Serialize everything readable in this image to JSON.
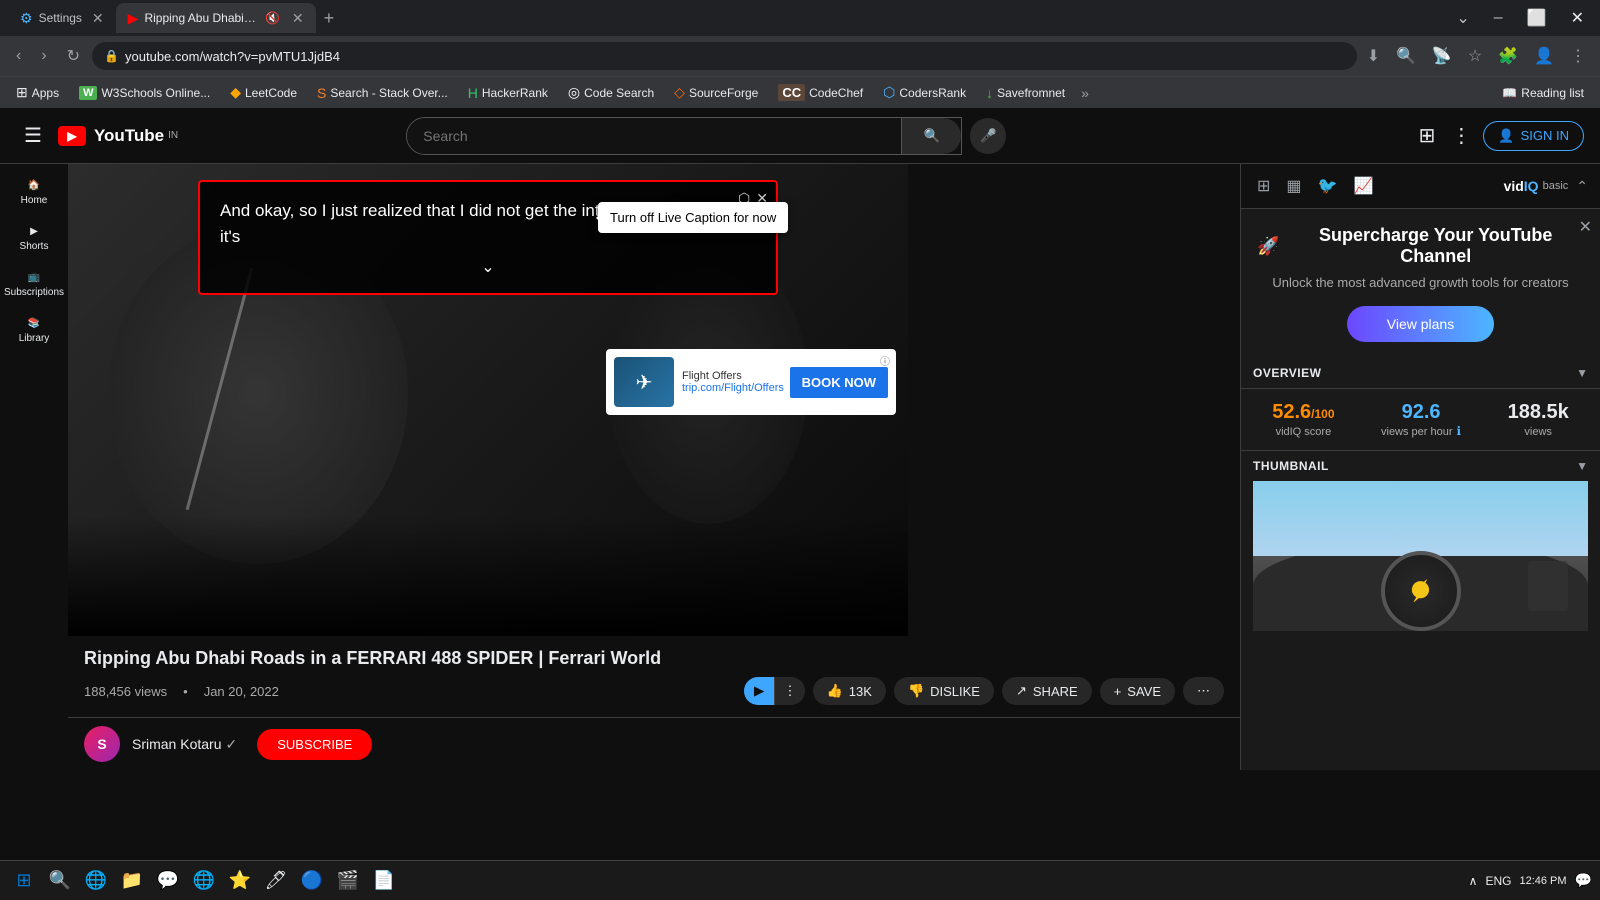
{
  "browser": {
    "tabs": [
      {
        "id": "settings",
        "title": "Settings",
        "favicon": "⚙",
        "active": false
      },
      {
        "id": "youtube",
        "title": "Ripping Abu Dhabi Roads in...",
        "favicon": "▶",
        "active": true,
        "muted": true
      }
    ],
    "address": "youtube.com/watch?v=pvMTU1JjdB4",
    "window_controls": [
      "⌄",
      "–",
      "⬜",
      "✕"
    ]
  },
  "bookmarks": [
    {
      "id": "apps",
      "label": "Apps",
      "icon": "⊞"
    },
    {
      "id": "w3schools",
      "label": "W3Schools Online...",
      "icon": "W"
    },
    {
      "id": "leetcode",
      "label": "LeetCode",
      "icon": "◆"
    },
    {
      "id": "stackoverflow",
      "label": "Search - Stack Over...",
      "icon": "S"
    },
    {
      "id": "hackerrank",
      "label": "HackerRank",
      "icon": "H"
    },
    {
      "id": "codesearch",
      "label": "Code Search",
      "icon": "◎"
    },
    {
      "id": "sourceforge",
      "label": "SourceForge",
      "icon": "◇"
    },
    {
      "id": "codechef",
      "label": "CodeChef",
      "icon": "C"
    },
    {
      "id": "codersrank",
      "label": "CodersRank",
      "icon": "⬡"
    },
    {
      "id": "savefromnet",
      "label": "Savefromnet",
      "icon": "↓"
    }
  ],
  "youtube": {
    "header": {
      "search_placeholder": "Search",
      "sign_in_label": "SIGN IN"
    },
    "video": {
      "title": "Ripping Abu Dhabi Roads in a FERRARI 488 SPIDER | Ferrari World",
      "views": "188,456 views",
      "date": "Jan 20, 2022",
      "likes": "13K",
      "channel": "Sriman Kotaru",
      "verified": true
    },
    "caption": {
      "text": "And okay, so I just realized that I did not get the intro till now so yeah it's",
      "turn_off_label": "Turn off Live Caption for now"
    },
    "ad": {
      "title": "Flight Offers",
      "url": "trip.com/Flight/Offers",
      "cta": "BOOK NOW"
    },
    "actions": {
      "like": "13K",
      "dislike": "DISLIKE",
      "share": "SHARE",
      "save": "SAVE"
    }
  },
  "vidiq": {
    "logo_text": "vidIQ",
    "plan": "basic",
    "promo": {
      "emoji": "🚀",
      "title": "Supercharge Your YouTube Channel",
      "subtitle": "Unlock the most advanced growth tools for creators",
      "cta": "View plans"
    },
    "overview_label": "OVERVIEW",
    "stats": [
      {
        "value": "52.6",
        "suffix": "/100",
        "label": "vidIQ score",
        "color": "orange"
      },
      {
        "value": "92.6",
        "suffix": "",
        "label": "views per hour",
        "color": "blue"
      },
      {
        "value": "188.5k",
        "suffix": "",
        "label": "views",
        "color": "white"
      }
    ],
    "thumbnail_label": "THUMBNAIL"
  },
  "taskbar": {
    "time": "12:46 PM",
    "language": "ENG",
    "icons": [
      "⊞",
      "🌐",
      "📁",
      "💬",
      "🌐",
      "⭐",
      "🖊",
      "🔵",
      "🎬",
      "📝"
    ]
  }
}
